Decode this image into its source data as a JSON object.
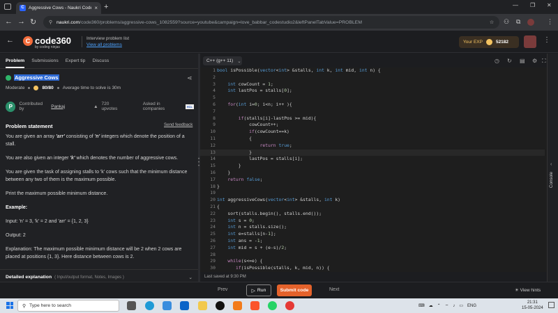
{
  "browser": {
    "tab_title": "Aggressive Cows - Naukri Code",
    "tab_icon_letter": "C",
    "url_host": "naukri.com",
    "url_path": "/code360/problems/aggressive-cows_1082559?source=youtube&campaign=love_babbar_codestudio2&leftPanelTabValue=PROBLEM"
  },
  "header": {
    "logo_text": "code360",
    "logo_sub": "by coding ninjas",
    "interview_label": "Interview problem list",
    "view_all": "View all problems",
    "exp_label": "Your EXP",
    "exp_value": "52182"
  },
  "left_tabs": [
    "Problem",
    "Submissions",
    "Expert tip",
    "Discuss"
  ],
  "problem": {
    "title": "Aggressive Cows",
    "difficulty": "Moderate",
    "score": "80/80",
    "avg_time": "Average time to solve is 30m",
    "contrib_initial": "P",
    "contributed_by": "Contributed by",
    "author": "Pankaj",
    "upvotes": "720 upvotes",
    "asked_in": "Asked in companies",
    "company_badge": "HCL",
    "statement_header": "Problem statement",
    "feedback": "Send feedback",
    "para1_a": "You are given an array ",
    "para1_b": "'arr'",
    "para1_c": " consisting of ",
    "para1_d": "'n'",
    "para1_e": " integers which denote the position of a stall.",
    "para2_a": "You are also given an integer ",
    "para2_b": "'k'",
    "para2_c": " which denotes the number of aggressive cows.",
    "para3": "You are given the task of assigning stalls to 'k' cows such that the minimum distance between any two of them is the maximum possible.",
    "para4": "Print the maximum possible minimum distance.",
    "example_header": "Example:",
    "input": "Input: 'n' = 3, 'k' = 2 and 'arr' = {1, 2, 3}",
    "output": "Output: 2",
    "explanation": "Explanation: The maximum possible minimum distance will be 2 when 2 cows are placed at positions {1, 3}. Here distance between cows is 2.",
    "detailed": "Detailed explanation",
    "detailed_sub": "( Input/output format, Notes, Images )"
  },
  "editor": {
    "language": "C++ (g++ 11)",
    "line_numbers": [
      "1",
      "2",
      "3",
      "4",
      "5",
      "6",
      "7",
      "8",
      "9",
      "10",
      "11",
      "12",
      "13",
      "14",
      "15",
      "16",
      "17",
      "18",
      "19",
      "20",
      "21",
      "22",
      "23",
      "24",
      "25",
      "26",
      "27",
      "28",
      "29",
      "30"
    ],
    "lines": [
      "bool isPossible(vector<int> &stalls, int k, int mid, int n) {",
      "",
      "    int cowCount = 1;",
      "    int lastPos = stalls[0];",
      "",
      "    for(int i=0; i<n; i++ ){",
      "",
      "        if(stalls[i]-lastPos >= mid){",
      "            cowCount++;",
      "            if(cowCount==k)",
      "            {",
      "                return true;",
      "            }",
      "            lastPos = stalls[i];",
      "        }",
      "    }",
      "    return false;",
      "}",
      "",
      "int aggressiveCows(vector<int> &stalls, int k)",
      "{",
      "    sort(stalls.begin(), stalls.end());",
      "    int s = 0;",
      "    int n = stalls.size();",
      "    int e=stalls[n-1];",
      "    int ans = -1;",
      "    int mid = s + (e-s)/2;",
      "",
      "    while(s<=e) {",
      "       if(isPossible(stalls, k, mid, n)) {"
    ],
    "saved": "Last saved at 9:30 PM",
    "console": "Console"
  },
  "bottom": {
    "prev": "Prev",
    "run": "Run",
    "submit": "Submit code",
    "next": "Next",
    "hints": "View hints"
  },
  "taskbar": {
    "search_placeholder": "Type here to search",
    "lang": "ENG",
    "time": "21:31",
    "date": "15-05-2024"
  },
  "colors": {
    "accent_orange": "#e4622b",
    "link_blue": "#4da3ff",
    "keyword": "#c586c0",
    "type": "#569cd6",
    "number": "#b5cea8"
  }
}
